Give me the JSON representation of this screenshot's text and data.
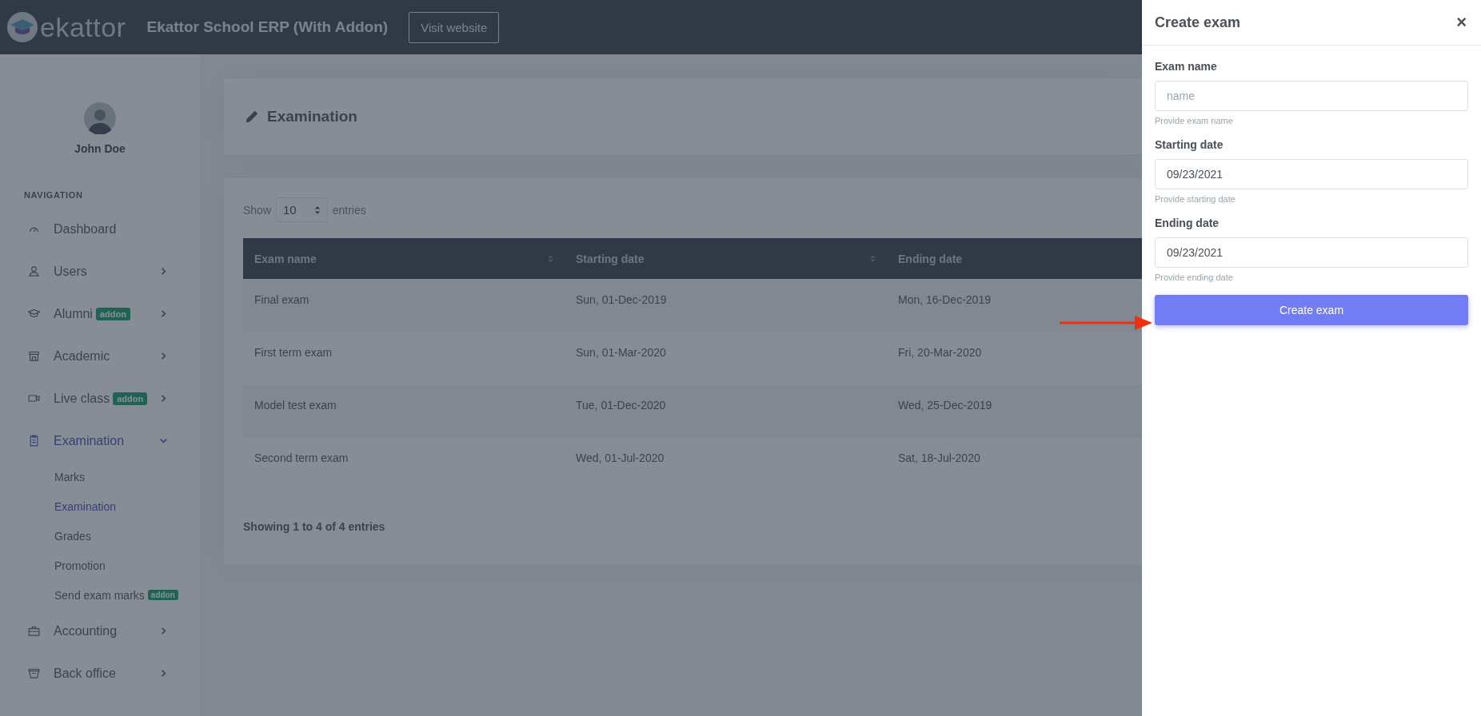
{
  "header": {
    "logo": "ekattor",
    "title": "Ekattor School ERP (With Addon)",
    "visit_button": "Visit website"
  },
  "user": {
    "name": "John Doe"
  },
  "sidebar": {
    "heading": "NAVIGATION",
    "items": [
      {
        "label": "Dashboard",
        "has_arrow": false,
        "selected": false
      },
      {
        "label": "Users",
        "has_arrow": true,
        "expanded": false,
        "selected": false
      },
      {
        "label": "Alumni",
        "badge": "addon",
        "has_arrow": true,
        "expanded": false,
        "selected": false
      },
      {
        "label": "Academic",
        "has_arrow": true,
        "expanded": false,
        "selected": false
      },
      {
        "label": "Live class",
        "badge": "addon",
        "has_arrow": true,
        "expanded": false,
        "selected": false
      },
      {
        "label": "Examination",
        "has_arrow": true,
        "expanded": true,
        "selected": true,
        "children": [
          {
            "label": "Marks",
            "selected": false
          },
          {
            "label": "Examination",
            "selected": true
          },
          {
            "label": "Grades",
            "selected": false
          },
          {
            "label": "Promotion",
            "selected": false
          },
          {
            "label": "Send exam marks",
            "badge": "addon",
            "selected": false
          }
        ]
      },
      {
        "label": "Accounting",
        "has_arrow": true,
        "expanded": false,
        "selected": false
      },
      {
        "label": "Back office",
        "has_arrow": true,
        "expanded": false,
        "selected": false
      }
    ]
  },
  "page_title": "Examination",
  "table": {
    "show_label": "Show",
    "page_size": "10",
    "entries_label": "entries",
    "columns": [
      {
        "label": "Exam name",
        "sortable": true
      },
      {
        "label": "Starting date",
        "sortable": true
      },
      {
        "label": "Ending date",
        "sortable": false
      }
    ],
    "rows": [
      [
        "Final exam",
        "Sun, 01-Dec-2019",
        "Mon, 16-Dec-2019"
      ],
      [
        "First term exam",
        "Sun, 01-Mar-2020",
        "Fri, 20-Mar-2020"
      ],
      [
        "Model test exam",
        "Tue, 01-Dec-2020",
        "Wed, 25-Dec-2019"
      ],
      [
        "Second term exam",
        "Wed, 01-Jul-2020",
        "Sat, 18-Jul-2020"
      ]
    ],
    "footer": "Showing 1 to 4 of 4 entries"
  },
  "drawer": {
    "title": "Create exam",
    "close": "×",
    "fields": [
      {
        "label": "Exam name",
        "placeholder": "name",
        "help": "Provide exam name"
      },
      {
        "label": "Starting date",
        "value": "09/23/2021",
        "help": "Provide starting date"
      },
      {
        "label": "Ending date",
        "value": "09/23/2021",
        "help": "Provide ending date"
      }
    ],
    "submit": "Create exam"
  }
}
